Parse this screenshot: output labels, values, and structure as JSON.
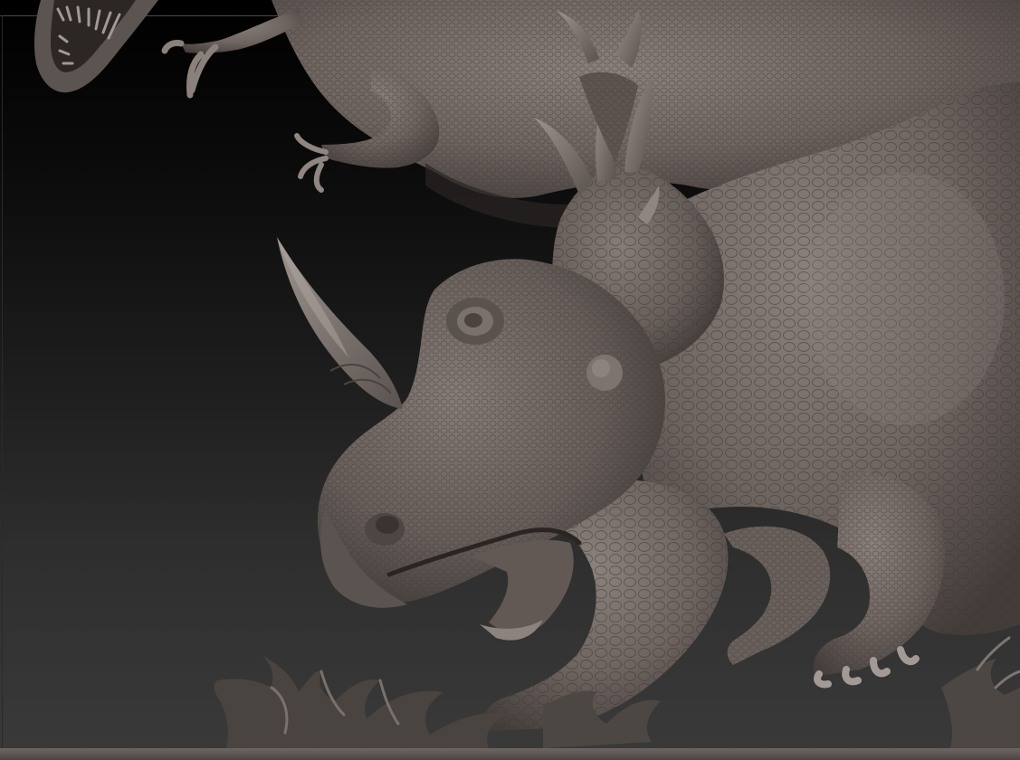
{
  "viewport": {
    "content": "3d-sculpt-render",
    "background_gradient": [
      "#000000",
      "#3a3a3a"
    ],
    "clay_color": "#6e6460"
  }
}
